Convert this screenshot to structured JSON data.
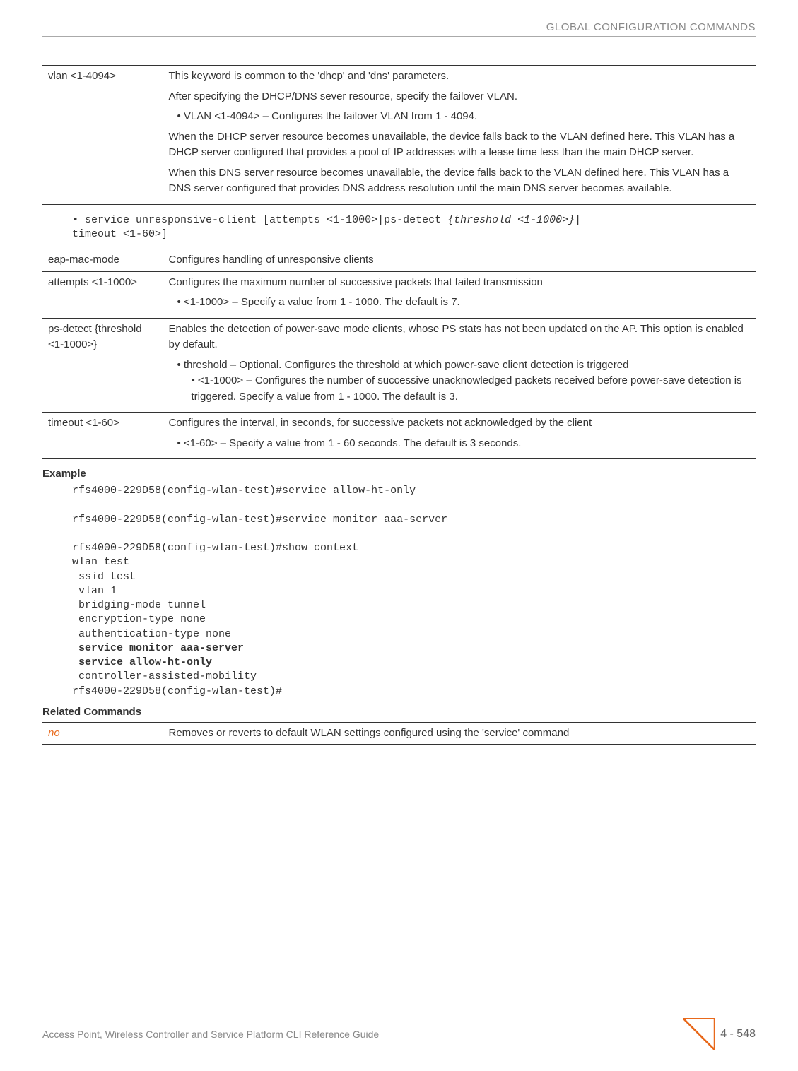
{
  "header": {
    "title": "GLOBAL CONFIGURATION COMMANDS"
  },
  "table1": {
    "row1": {
      "param": "vlan <1-4094>",
      "p1": "This keyword is common to the 'dhcp' and 'dns' parameters.",
      "p2": "After specifying the DHCP/DNS sever resource, specify the failover VLAN.",
      "b1": "VLAN <1-4094> – Configures the failover VLAN from 1 - 4094.",
      "p3": "When the DHCP server resource becomes unavailable, the device falls back to the VLAN defined here. This VLAN has a DHCP server configured that provides a pool of IP addresses with a lease time less than the main DHCP server.",
      "p4": "When this DNS server resource becomes unavailable, the device falls back to the VLAN defined here. This VLAN has a DNS server configured that provides DNS address resolution until the main DNS server becomes available."
    }
  },
  "cmd1": {
    "prefix": "• service unresponsive-client [attempts <1-1000>|ps-detect ",
    "italic": "{threshold <1-1000>}",
    "suffix": "|\ntimeout <1-60>]"
  },
  "table2": {
    "row1": {
      "param": "eap-mac-mode",
      "desc": "Configures handling of unresponsive clients"
    },
    "row2": {
      "param": "attempts <1-1000>",
      "p1": "Configures the maximum number of successive packets that failed transmission",
      "b1": "<1-1000> – Specify a value from 1 - 1000. The default is 7."
    },
    "row3": {
      "param": "ps-detect {threshold <1-1000>}",
      "p1": "Enables the detection of power-save mode clients, whose PS stats has not been updated on the AP. This option is enabled by default.",
      "b1": "threshold – Optional. Configures the threshold at which power-save client detection is triggered",
      "b1n1": "<1-1000> – Configures the number of successive unacknowledged packets received before power-save detection is triggered. Specify a value from 1 - 1000. The default is 3."
    },
    "row4": {
      "param": "timeout <1-60>",
      "p1": "Configures the interval, in seconds, for successive packets not acknowledged by the client",
      "b1": "<1-60> – Specify a value from 1 - 60 seconds. The default is 3 seconds."
    }
  },
  "sections": {
    "example": "Example",
    "related": "Related Commands"
  },
  "example": {
    "l1": "rfs4000-229D58(config-wlan-test)#service allow-ht-only",
    "l2": "rfs4000-229D58(config-wlan-test)#service monitor aaa-server",
    "l3": "rfs4000-229D58(config-wlan-test)#show context",
    "l4": "wlan test",
    "l5": " ssid test",
    "l6": " vlan 1",
    "l7": " bridging-mode tunnel",
    "l8": " encryption-type none",
    "l9": " authentication-type none",
    "l10": " service monitor aaa-server",
    "l11": " service allow-ht-only",
    "l12": " controller-assisted-mobility",
    "l13": "rfs4000-229D58(config-wlan-test)#"
  },
  "table3": {
    "row1": {
      "param": "no",
      "desc": "Removes or reverts to default WLAN settings configured using the 'service' command"
    }
  },
  "footer": {
    "left": "Access Point, Wireless Controller and Service Platform CLI Reference Guide",
    "page": "4 - 548"
  }
}
